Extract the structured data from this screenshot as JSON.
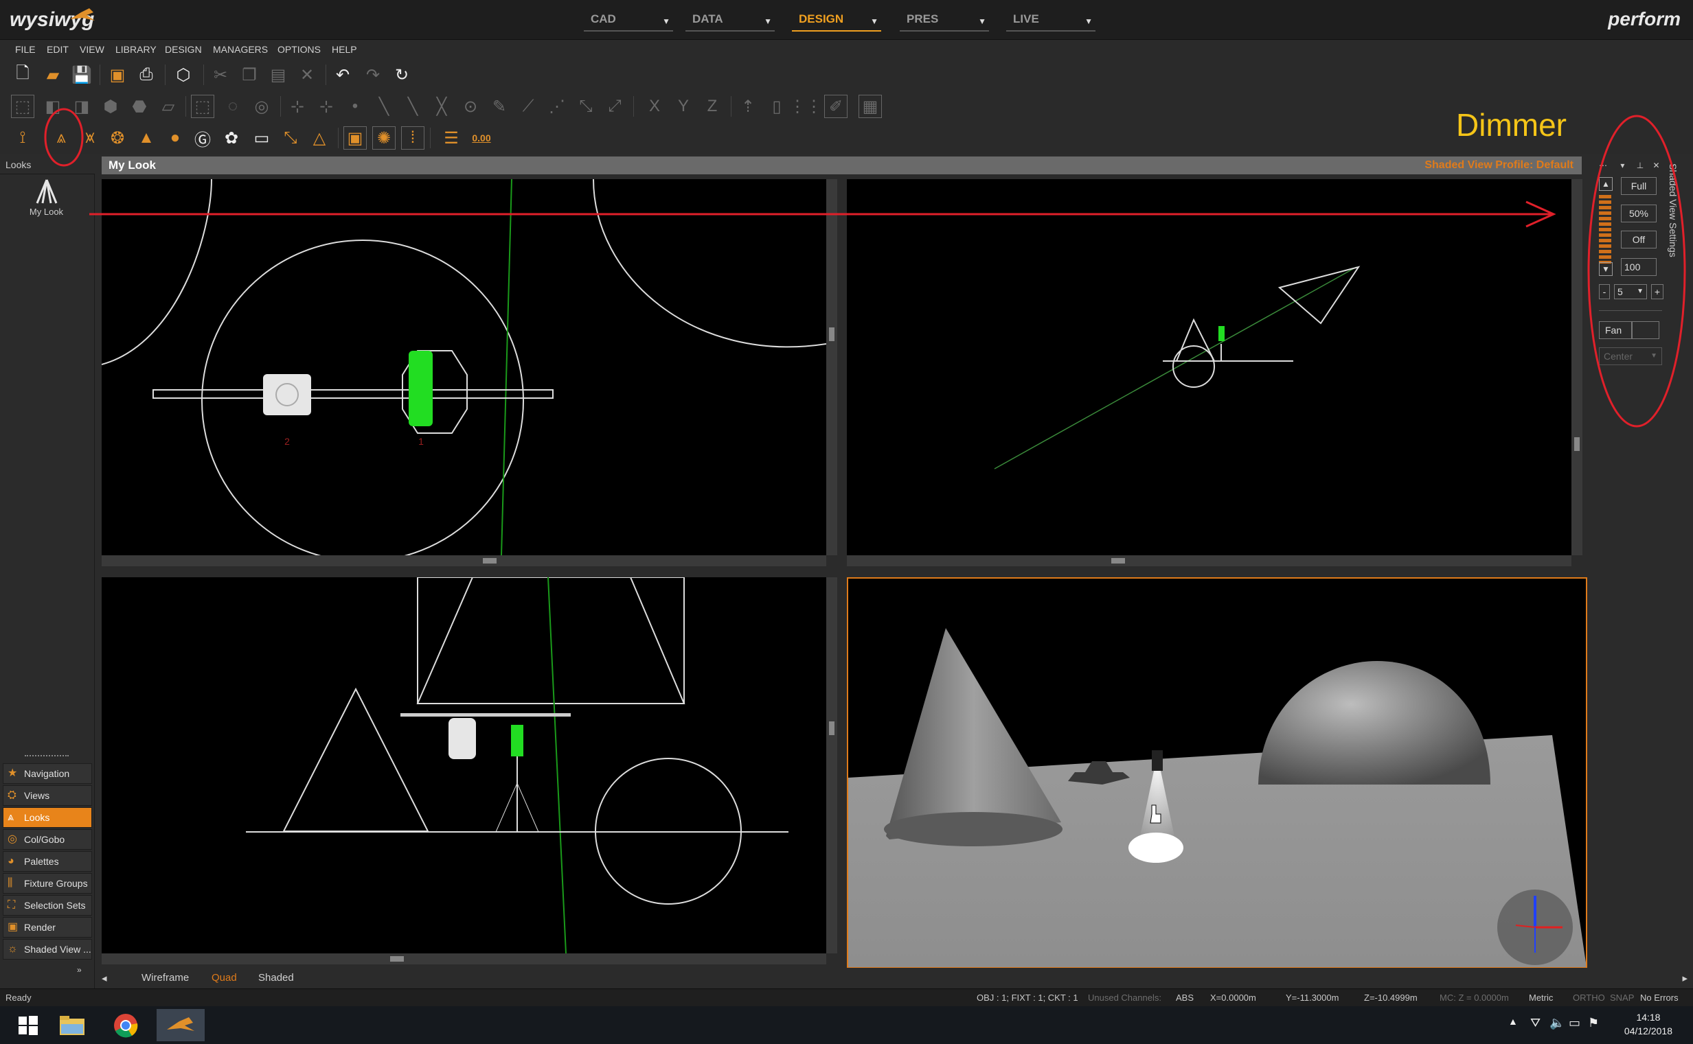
{
  "app": {
    "logo": "wysiwyg",
    "edition": "perform",
    "mode_tabs": [
      "CAD",
      "DATA",
      "DESIGN",
      "PRES",
      "LIVE"
    ],
    "active_mode": "DESIGN"
  },
  "menu": [
    "FILE",
    "EDIT",
    "VIEW",
    "LIBRARY",
    "DESIGN",
    "MANAGERS",
    "OPTIONS",
    "HELP"
  ],
  "toolbar": {
    "value_readout": "0.00",
    "axis_x": "X",
    "axis_y": "Y",
    "axis_z": "Z"
  },
  "left_panel": {
    "header": "Looks",
    "items": [
      {
        "label": "My Look"
      }
    ],
    "nav": [
      {
        "label": "Navigation",
        "icon": "star-icon"
      },
      {
        "label": "Views",
        "icon": "views-icon"
      },
      {
        "label": "Looks",
        "icon": "looks-icon",
        "active": true
      },
      {
        "label": "Col/Gobo",
        "icon": "gobo-icon"
      },
      {
        "label": "Palettes",
        "icon": "palette-icon"
      },
      {
        "label": "Fixture Groups",
        "icon": "fixture-groups-icon"
      },
      {
        "label": "Selection Sets",
        "icon": "selection-sets-icon"
      },
      {
        "label": "Render",
        "icon": "render-icon"
      },
      {
        "label": "Shaded View ...",
        "icon": "shaded-view-icon"
      }
    ]
  },
  "main": {
    "title": "My Look",
    "profile": "Shaded View Profile: Default",
    "fixture_labels": [
      "2",
      "1"
    ],
    "view_tabs": [
      "Wireframe",
      "Quad",
      "Shaded"
    ],
    "active_view_tab": "Quad"
  },
  "right_panel": {
    "title": "Shaded View Settings",
    "buttons": {
      "full": "Full",
      "half": "50%",
      "off": "Off"
    },
    "level_value": "100",
    "step_value": "5",
    "fan_label": "Fan",
    "center_select": "Center"
  },
  "annotation": {
    "label": "Dimmer"
  },
  "status": {
    "ready": "Ready",
    "obj": "OBJ : 1; FIXT : 1; CKT : 1",
    "unused": "Unused Channels:",
    "abs": "ABS",
    "x": "X=0.0000m",
    "y": "Y=-11.3000m",
    "z": "Z=-10.4999m",
    "mc": "MC: Z = 0.0000m",
    "metric": "Metric",
    "ortho": "ORTHO",
    "snap": "SNAP",
    "errors": "No Errors"
  },
  "taskbar": {
    "time": "14:18",
    "date": "04/12/2018"
  },
  "colors": {
    "accent": "#e8841a",
    "annotation_red": "#e0202a",
    "annotation_yellow": "#f5c518",
    "beam_green": "#22dd22"
  }
}
